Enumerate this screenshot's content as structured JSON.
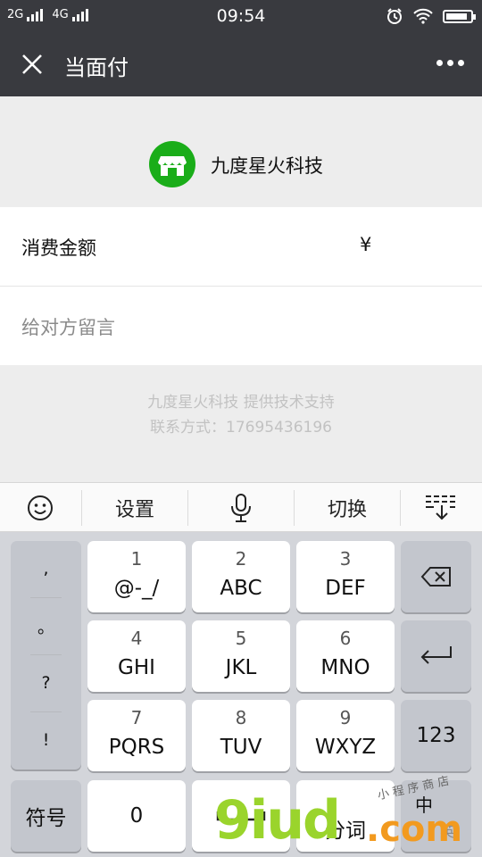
{
  "status_bar": {
    "network1": "2G",
    "network2": "4G",
    "time": "09:54",
    "alarm_icon": "alarm-clock-icon",
    "wifi_icon": "wifi-icon",
    "battery_level": 0.9
  },
  "header": {
    "title": "当面付",
    "close_icon": "close-icon",
    "more_icon": "more-dots-icon"
  },
  "merchant": {
    "name": "九度星火科技",
    "icon": "storefront-icon",
    "brand_color": "#1aad19"
  },
  "form": {
    "amount_label": "消费金额",
    "currency_symbol": "¥",
    "amount_value": "",
    "remark_link": "给对方留言"
  },
  "footer": {
    "line1": "九度星火科技 提供技术支持",
    "line2": "联系方式：17695436196"
  },
  "keyboard_toolbar": {
    "emoji_icon": "smiley-icon",
    "settings": "设置",
    "mic_icon": "microphone-icon",
    "switch": "切换",
    "collapse_icon": "keyboard-collapse-icon"
  },
  "keyboard": {
    "punctuation": [
      ",",
      "。",
      "?",
      "!"
    ],
    "keys": [
      {
        "num": "1",
        "letters": "@-_/"
      },
      {
        "num": "2",
        "letters": "ABC"
      },
      {
        "num": "3",
        "letters": "DEF"
      },
      {
        "num": "4",
        "letters": "GHI"
      },
      {
        "num": "5",
        "letters": "JKL"
      },
      {
        "num": "6",
        "letters": "MNO"
      },
      {
        "num": "7",
        "letters": "PQRS"
      },
      {
        "num": "8",
        "letters": "TUV"
      },
      {
        "num": "9",
        "letters": "WXYZ"
      }
    ],
    "backspace_icon": "backspace-icon",
    "enter_icon": "enter-icon",
    "num_mode": "123",
    "symbols": "符号",
    "zero": "0",
    "space_icon": "space-icon",
    "split_word": "分词",
    "lang_cn": "中",
    "lang_en": "英"
  },
  "watermark": {
    "text1": "9iud",
    "text2": ".com",
    "text3": "小 程 序 商 店"
  }
}
